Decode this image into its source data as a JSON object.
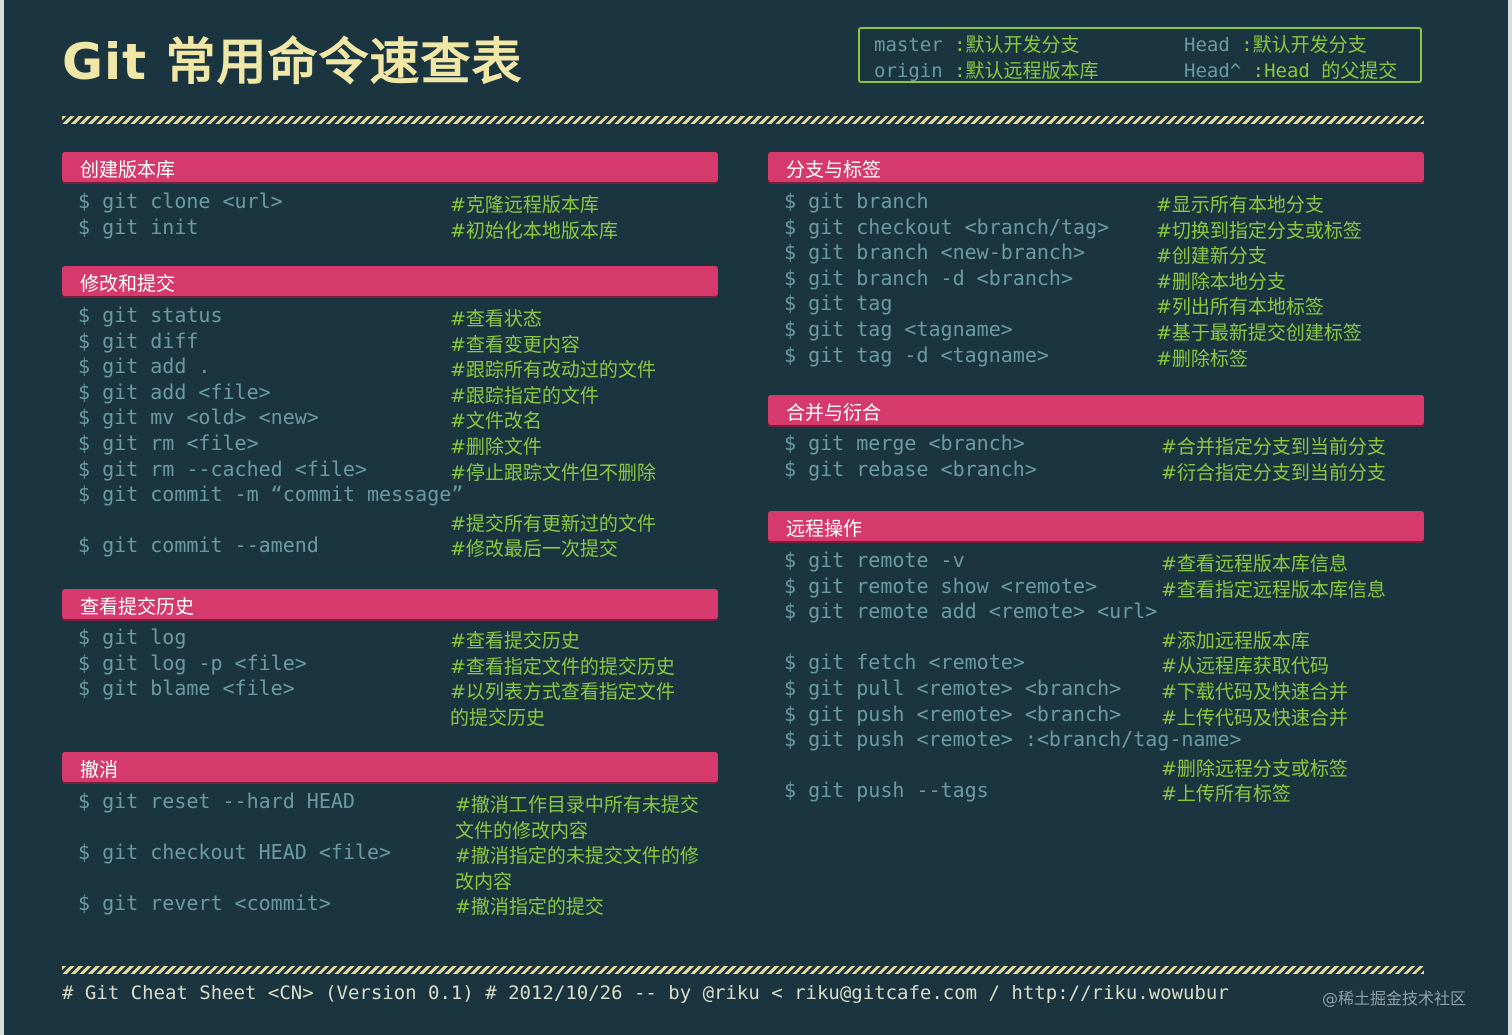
{
  "title": "Git 常用命令速查表",
  "legend": {
    "master_key": "master",
    "master_val": " :默认开发分支",
    "origin_key": "origin",
    "origin_val": " :默认远程版本库",
    "head_key": "Head",
    "head_val": " :默认开发分支",
    "headp_key": "Head^",
    "headp_val": " :Head 的父提交"
  },
  "sections": {
    "create": {
      "title": "创建版本库",
      "rows": [
        {
          "cmd": "$ git clone <url>",
          "note": "#克隆远程版本库"
        },
        {
          "cmd": "$ git init",
          "note": "#初始化本地版本库"
        }
      ]
    },
    "modify": {
      "title": "修改和提交",
      "rows": [
        {
          "cmd": "$ git status",
          "note": "#查看状态"
        },
        {
          "cmd": "$ git diff",
          "note": "#查看变更内容"
        },
        {
          "cmd": "$ git add .",
          "note": "#跟踪所有改动过的文件"
        },
        {
          "cmd": "$ git add <file>",
          "note": "#跟踪指定的文件"
        },
        {
          "cmd": "$ git mv <old> <new>",
          "note": "#文件改名"
        },
        {
          "cmd": "$ git rm <file>",
          "note": "#删除文件"
        },
        {
          "cmd": "$ git rm --cached <file>",
          "note": "#停止跟踪文件但不删除"
        },
        {
          "cmd": "$ git commit -m “commit message”",
          "note": ""
        },
        {
          "cmd": "",
          "note": "#提交所有更新过的文件"
        },
        {
          "cmd": "$ git commit --amend",
          "note": "#修改最后一次提交"
        }
      ]
    },
    "history": {
      "title": "查看提交历史",
      "rows": [
        {
          "cmd": "$ git log",
          "note": "#查看提交历史"
        },
        {
          "cmd": "$ git log -p <file>",
          "note": "#查看指定文件的提交历史"
        },
        {
          "cmd": "$ git blame <file>",
          "note": "#以列表方式查看指定文件"
        },
        {
          "cmd": "",
          "note": "的提交历史"
        }
      ]
    },
    "undo": {
      "title": "撤消",
      "rows": [
        {
          "cmd": "$ git reset --hard HEAD",
          "note": "#撤消工作目录中所有未提交"
        },
        {
          "cmd": "",
          "note": "文件的修改内容"
        },
        {
          "cmd": "$ git checkout HEAD <file>",
          "note": "#撤消指定的未提交文件的修"
        },
        {
          "cmd": "",
          "note": "改内容"
        },
        {
          "cmd": "$ git revert <commit>",
          "note": "#撤消指定的提交"
        }
      ]
    },
    "branch": {
      "title": "分支与标签",
      "rows": [
        {
          "cmd": "$ git branch",
          "note": "#显示所有本地分支"
        },
        {
          "cmd": "$ git checkout <branch/tag>",
          "note": "#切换到指定分支或标签"
        },
        {
          "cmd": "$ git branch <new-branch>",
          "note": "#创建新分支"
        },
        {
          "cmd": "$ git branch -d <branch>",
          "note": "#删除本地分支"
        },
        {
          "cmd": "$ git tag",
          "note": "#列出所有本地标签"
        },
        {
          "cmd": "$ git tag <tagname>",
          "note": "#基于最新提交创建标签"
        },
        {
          "cmd": "$ git tag -d <tagname>",
          "note": "#删除标签"
        }
      ]
    },
    "merge": {
      "title": "合并与衍合",
      "rows": [
        {
          "cmd": "$ git merge <branch>",
          "note": "#合并指定分支到当前分支"
        },
        {
          "cmd": "$ git rebase <branch>",
          "note": "#衍合指定分支到当前分支"
        }
      ]
    },
    "remote": {
      "title": "远程操作",
      "rows": [
        {
          "cmd": "$ git remote -v",
          "note": "#查看远程版本库信息"
        },
        {
          "cmd": "$ git remote show <remote>",
          "note": "#查看指定远程版本库信息"
        },
        {
          "cmd": "$ git remote add <remote> <url>",
          "note": ""
        },
        {
          "cmd": "",
          "note": "#添加远程版本库"
        },
        {
          "cmd": "$ git fetch <remote>",
          "note": "#从远程库获取代码"
        },
        {
          "cmd": "$ git pull <remote> <branch>",
          "note": "#下载代码及快速合并"
        },
        {
          "cmd": "$ git push <remote> <branch>",
          "note": "#上传代码及快速合并"
        },
        {
          "cmd": "$ git push <remote> :<branch/tag-name>",
          "note": ""
        },
        {
          "cmd": "",
          "note": "#删除远程分支或标签"
        },
        {
          "cmd": "$ git push --tags",
          "note": "#上传所有标签"
        }
      ]
    }
  },
  "footer": "# Git Cheat Sheet <CN> (Version 0.1)     # 2012/10/26  -- by @riku  < riku@gitcafe.com / http://riku.wowubur",
  "watermark": "@稀土掘金技术社区"
}
